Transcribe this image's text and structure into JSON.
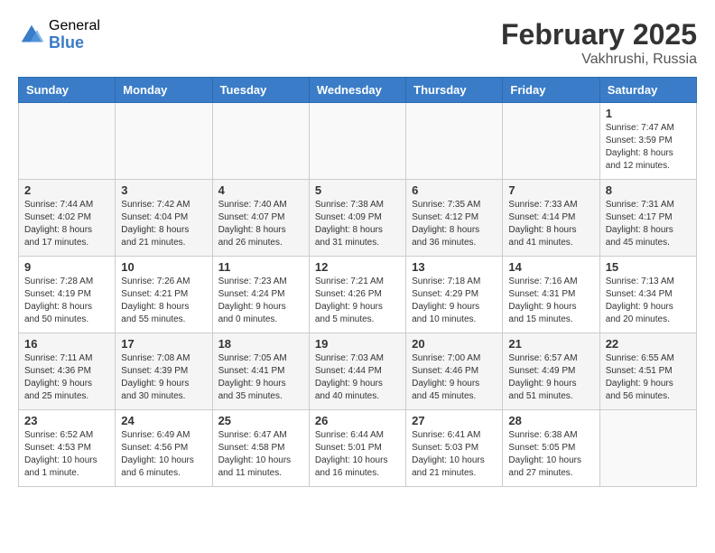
{
  "header": {
    "logo_general": "General",
    "logo_blue": "Blue",
    "month_title": "February 2025",
    "location": "Vakhrushi, Russia"
  },
  "days_of_week": [
    "Sunday",
    "Monday",
    "Tuesday",
    "Wednesday",
    "Thursday",
    "Friday",
    "Saturday"
  ],
  "weeks": [
    [
      {
        "day": "",
        "info": ""
      },
      {
        "day": "",
        "info": ""
      },
      {
        "day": "",
        "info": ""
      },
      {
        "day": "",
        "info": ""
      },
      {
        "day": "",
        "info": ""
      },
      {
        "day": "",
        "info": ""
      },
      {
        "day": "1",
        "info": "Sunrise: 7:47 AM\nSunset: 3:59 PM\nDaylight: 8 hours and 12 minutes."
      }
    ],
    [
      {
        "day": "2",
        "info": "Sunrise: 7:44 AM\nSunset: 4:02 PM\nDaylight: 8 hours and 17 minutes."
      },
      {
        "day": "3",
        "info": "Sunrise: 7:42 AM\nSunset: 4:04 PM\nDaylight: 8 hours and 21 minutes."
      },
      {
        "day": "4",
        "info": "Sunrise: 7:40 AM\nSunset: 4:07 PM\nDaylight: 8 hours and 26 minutes."
      },
      {
        "day": "5",
        "info": "Sunrise: 7:38 AM\nSunset: 4:09 PM\nDaylight: 8 hours and 31 minutes."
      },
      {
        "day": "6",
        "info": "Sunrise: 7:35 AM\nSunset: 4:12 PM\nDaylight: 8 hours and 36 minutes."
      },
      {
        "day": "7",
        "info": "Sunrise: 7:33 AM\nSunset: 4:14 PM\nDaylight: 8 hours and 41 minutes."
      },
      {
        "day": "8",
        "info": "Sunrise: 7:31 AM\nSunset: 4:17 PM\nDaylight: 8 hours and 45 minutes."
      }
    ],
    [
      {
        "day": "9",
        "info": "Sunrise: 7:28 AM\nSunset: 4:19 PM\nDaylight: 8 hours and 50 minutes."
      },
      {
        "day": "10",
        "info": "Sunrise: 7:26 AM\nSunset: 4:21 PM\nDaylight: 8 hours and 55 minutes."
      },
      {
        "day": "11",
        "info": "Sunrise: 7:23 AM\nSunset: 4:24 PM\nDaylight: 9 hours and 0 minutes."
      },
      {
        "day": "12",
        "info": "Sunrise: 7:21 AM\nSunset: 4:26 PM\nDaylight: 9 hours and 5 minutes."
      },
      {
        "day": "13",
        "info": "Sunrise: 7:18 AM\nSunset: 4:29 PM\nDaylight: 9 hours and 10 minutes."
      },
      {
        "day": "14",
        "info": "Sunrise: 7:16 AM\nSunset: 4:31 PM\nDaylight: 9 hours and 15 minutes."
      },
      {
        "day": "15",
        "info": "Sunrise: 7:13 AM\nSunset: 4:34 PM\nDaylight: 9 hours and 20 minutes."
      }
    ],
    [
      {
        "day": "16",
        "info": "Sunrise: 7:11 AM\nSunset: 4:36 PM\nDaylight: 9 hours and 25 minutes."
      },
      {
        "day": "17",
        "info": "Sunrise: 7:08 AM\nSunset: 4:39 PM\nDaylight: 9 hours and 30 minutes."
      },
      {
        "day": "18",
        "info": "Sunrise: 7:05 AM\nSunset: 4:41 PM\nDaylight: 9 hours and 35 minutes."
      },
      {
        "day": "19",
        "info": "Sunrise: 7:03 AM\nSunset: 4:44 PM\nDaylight: 9 hours and 40 minutes."
      },
      {
        "day": "20",
        "info": "Sunrise: 7:00 AM\nSunset: 4:46 PM\nDaylight: 9 hours and 45 minutes."
      },
      {
        "day": "21",
        "info": "Sunrise: 6:57 AM\nSunset: 4:49 PM\nDaylight: 9 hours and 51 minutes."
      },
      {
        "day": "22",
        "info": "Sunrise: 6:55 AM\nSunset: 4:51 PM\nDaylight: 9 hours and 56 minutes."
      }
    ],
    [
      {
        "day": "23",
        "info": "Sunrise: 6:52 AM\nSunset: 4:53 PM\nDaylight: 10 hours and 1 minute."
      },
      {
        "day": "24",
        "info": "Sunrise: 6:49 AM\nSunset: 4:56 PM\nDaylight: 10 hours and 6 minutes."
      },
      {
        "day": "25",
        "info": "Sunrise: 6:47 AM\nSunset: 4:58 PM\nDaylight: 10 hours and 11 minutes."
      },
      {
        "day": "26",
        "info": "Sunrise: 6:44 AM\nSunset: 5:01 PM\nDaylight: 10 hours and 16 minutes."
      },
      {
        "day": "27",
        "info": "Sunrise: 6:41 AM\nSunset: 5:03 PM\nDaylight: 10 hours and 21 minutes."
      },
      {
        "day": "28",
        "info": "Sunrise: 6:38 AM\nSunset: 5:05 PM\nDaylight: 10 hours and 27 minutes."
      },
      {
        "day": "",
        "info": ""
      }
    ]
  ]
}
